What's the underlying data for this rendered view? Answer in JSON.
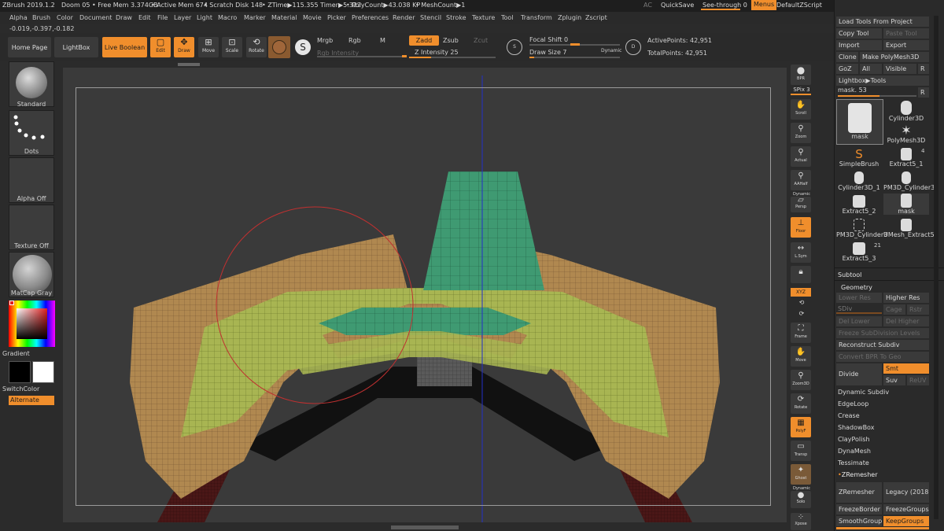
{
  "app": {
    "title": "ZBrush 2019.1.2",
    "doc": "Doom 05",
    "free_mem": "• Free Mem 3.374GB",
    "active_mem": "• Active Mem 674",
    "scratch": "• Scratch Disk 148",
    "ztime": "• ZTime▶115.355 Timer▶5.322",
    "polycount": "• PolyCount▶43.038 KP",
    "meshcount": "• MeshCount▶1",
    "ac": "AC",
    "quicksave": "QuickSave",
    "seethrough": "See-through  0",
    "menus": "Menus",
    "defaultscript": "DefaultZScript"
  },
  "menus": [
    "Alpha",
    "Brush",
    "Color",
    "Document",
    "Draw",
    "Edit",
    "File",
    "Layer",
    "Light",
    "Macro",
    "Marker",
    "Material",
    "Movie",
    "Picker",
    "Preferences",
    "Render",
    "Stencil",
    "Stroke",
    "Texture",
    "Tool",
    "Transform",
    "Zplugin",
    "Zscript"
  ],
  "coords": "-0.019,-0.397,-0.182",
  "toolbar": {
    "home": "Home Page",
    "lightbox": "LightBox",
    "liveboolean": "Live Boolean",
    "edit": "Edit",
    "draw": "Draw",
    "move": "Move",
    "scale": "Scale",
    "rotate": "Rotate",
    "mrgb": "Mrgb",
    "rgb": "Rgb",
    "m": "M",
    "rgb_intensity": "Rgb Intensity",
    "zadd": "Zadd",
    "zsub": "Zsub",
    "zcut": "Zcut",
    "z_intensity": "Z Intensity 25",
    "focal_shift": "Focal Shift 0",
    "draw_size": "Draw Size 7",
    "dynamic": "Dynamic",
    "active_points": "ActivePoints: 42,951",
    "total_points": "TotalPoints: 42,951",
    "z_intensity_value": 25,
    "draw_size_value": 7
  },
  "left": {
    "brush": "Standard",
    "stroke": "Dots",
    "alpha": "Alpha Off",
    "texture": "Texture Off",
    "material": "MatCap Gray",
    "gradient": "Gradient",
    "switchcolor": "SwitchColor",
    "alternate": "Alternate"
  },
  "right_shelf": [
    "BPR",
    "SPix 3",
    "Scroll",
    "Zoom",
    "Actual",
    "AAHalf",
    "Dynamic",
    "Persp",
    "Floor",
    "L.Sym",
    "",
    "XYZ",
    "",
    "",
    "Frame",
    "Move",
    "Zoom3D",
    "Rotate",
    "PolyF",
    "Transp",
    "Ghost",
    "Dynamic",
    "Solo",
    "Xpose"
  ],
  "tray": {
    "load_tools": "Load Tools From Project",
    "copy_tool": "Copy Tool",
    "paste_tool": "Paste Tool",
    "import": "Import",
    "export": "Export",
    "clone": "Clone",
    "make_polymesh": "Make PolyMesh3D",
    "goz": "GoZ",
    "all": "All",
    "visible": "Visible",
    "r": "R",
    "lightbox_tools": "Lightbox▶Tools",
    "mask_slider": "mask. 53",
    "tools": [
      {
        "name": "mask",
        "count": ""
      },
      {
        "name": "Cylinder3D",
        "count": ""
      },
      {
        "name": "PolyMesh3D",
        "count": ""
      },
      {
        "name": "SimpleBrush",
        "count": ""
      },
      {
        "name": "Extract5_1",
        "count": "4"
      },
      {
        "name": "Cylinder3D_1",
        "count": ""
      },
      {
        "name": "PM3D_Cylinder3",
        "count": ""
      },
      {
        "name": "Extract5_2",
        "count": ""
      },
      {
        "name": "mask",
        "count": ""
      },
      {
        "name": "PM3D_Cylinder3",
        "count": ""
      },
      {
        "name": "UMesh_Extract5",
        "count": ""
      },
      {
        "name": "Extract5_3",
        "count": "21"
      }
    ],
    "subtool": "Subtool",
    "geometry": "Geometry",
    "lower_res": "Lower Res",
    "higher_res": "Higher Res",
    "sdiv": "SDiv",
    "cage": "Cage",
    "rstr": "Rstr",
    "del_lower": "Del Lower",
    "del_higher": "Del Higher",
    "freeze_subdiv": "Freeze SubDivision Levels",
    "reconstruct": "Reconstruct Subdiv",
    "convert_bpr": "Convert BPR To Geo",
    "divide": "Divide",
    "smt": "Smt",
    "suv": "Suv",
    "reuv": "ReUV",
    "dynamic_subdiv": "Dynamic Subdiv",
    "edgeloop": "EdgeLoop",
    "crease": "Crease",
    "shadowbox": "ShadowBox",
    "claypolish": "ClayPolish",
    "dynamesh": "DynaMesh",
    "tessimate": "Tessimate",
    "zremesher_head": "ZRemesher",
    "zremesher": "ZRemesher",
    "legacy": "Legacy (2018)",
    "freezeborder": "FreezeBorder",
    "freezegroups": "FreezeGroups",
    "smoothgroups": "SmoothGroups",
    "keepgroups": "KeepGroups",
    "mask_value": 53
  },
  "colors": {
    "accent": "#f08e2c",
    "mesh_tan": "#b08850",
    "mesh_green": "#3f9a72",
    "mesh_olive": "#a8b552",
    "brush_circle": "#c03030",
    "axis_line": "#2330c8"
  }
}
